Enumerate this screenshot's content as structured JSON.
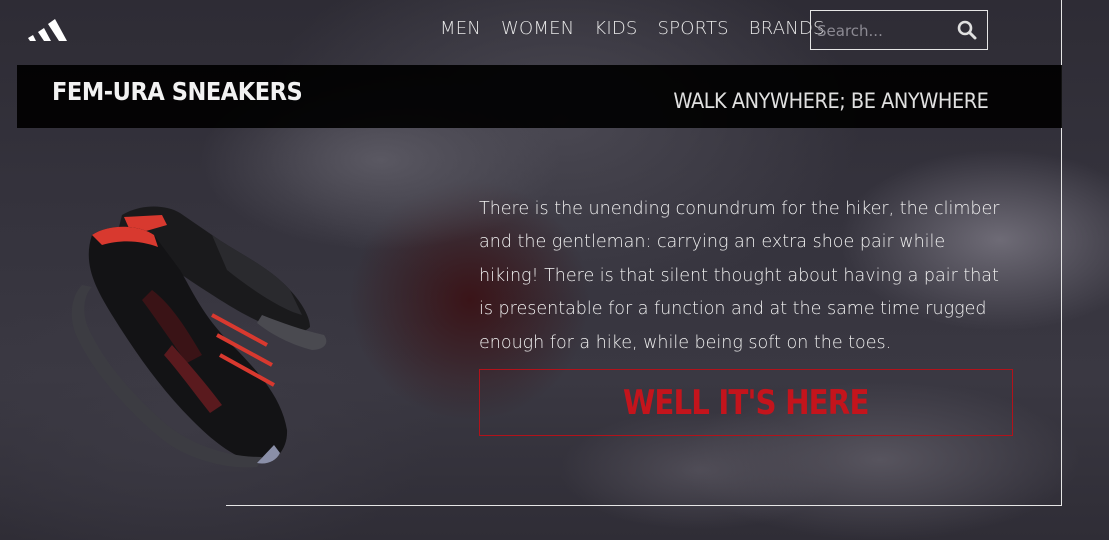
{
  "nav": {
    "items": [
      {
        "label": "MEN"
      },
      {
        "label": "WOMEN"
      },
      {
        "label": "KIDS"
      },
      {
        "label": "SPORTS"
      },
      {
        "label": "BRANDS"
      }
    ]
  },
  "search": {
    "placeholder": "Search...",
    "icon": "search-icon"
  },
  "hero": {
    "product_title": "FEM-URA SNEAKERS",
    "tagline": "WALK ANYWHERE; BE ANYWHERE",
    "description": "There is the unending conundrum for the hiker, the climber and the gentleman: carrying an extra shoe pair while hiking! There is that silent thought about having a pair that is presentable for a function and at the same time rugged enough for a hike, while being soft on the toes.",
    "cta_label": "WELL IT'S HERE"
  },
  "colors": {
    "accent": "#c4141c",
    "title_bar": "#000000",
    "text": "#f0f0f0"
  },
  "icons": {
    "logo": "adidas-logo-icon",
    "search": "search-icon"
  }
}
